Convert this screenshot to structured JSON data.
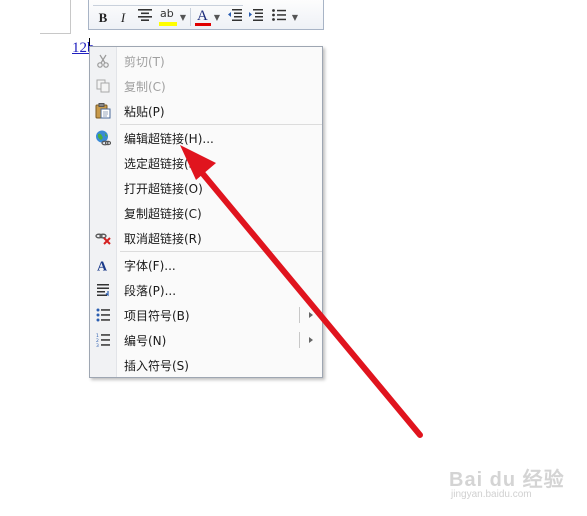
{
  "toolbar": {
    "bold_label": "B",
    "italic_label": "I",
    "highlight_label": "ab",
    "font_color_label": "A"
  },
  "document": {
    "link_text": "12b"
  },
  "context_menu": {
    "items": [
      {
        "label": "剪切(T)",
        "icon": "scissors-icon",
        "enabled": false
      },
      {
        "label": "复制(C)",
        "icon": "copy-icon",
        "enabled": false
      },
      {
        "label": "粘贴(P)",
        "icon": "paste-icon",
        "enabled": true
      },
      {
        "label": "编辑超链接(H)...",
        "icon": "hyperlink-globe-icon",
        "enabled": true
      },
      {
        "label": "选定超链接(S)",
        "icon": "",
        "enabled": true
      },
      {
        "label": "打开超链接(O)",
        "icon": "",
        "enabled": true
      },
      {
        "label": "复制超链接(C)",
        "icon": "",
        "enabled": true
      },
      {
        "label": "取消超链接(R)",
        "icon": "remove-hyperlink-icon",
        "enabled": true
      },
      {
        "label": "字体(F)...",
        "icon": "font-icon",
        "enabled": true
      },
      {
        "label": "段落(P)...",
        "icon": "paragraph-icon",
        "enabled": true
      },
      {
        "label": "项目符号(B)",
        "icon": "bullets-icon",
        "enabled": true,
        "submenu": true
      },
      {
        "label": "编号(N)",
        "icon": "numbering-icon",
        "enabled": true,
        "submenu": true
      },
      {
        "label": "插入符号(S)",
        "icon": "",
        "enabled": true
      }
    ]
  },
  "colors": {
    "annotation_arrow": "#e0141e",
    "link": "#1f1fbf",
    "highlight": "#ffff00",
    "font_color": "#e00000"
  },
  "watermark": {
    "line1": "Bai du 经验",
    "line2": "jingyan.baidu.com"
  }
}
